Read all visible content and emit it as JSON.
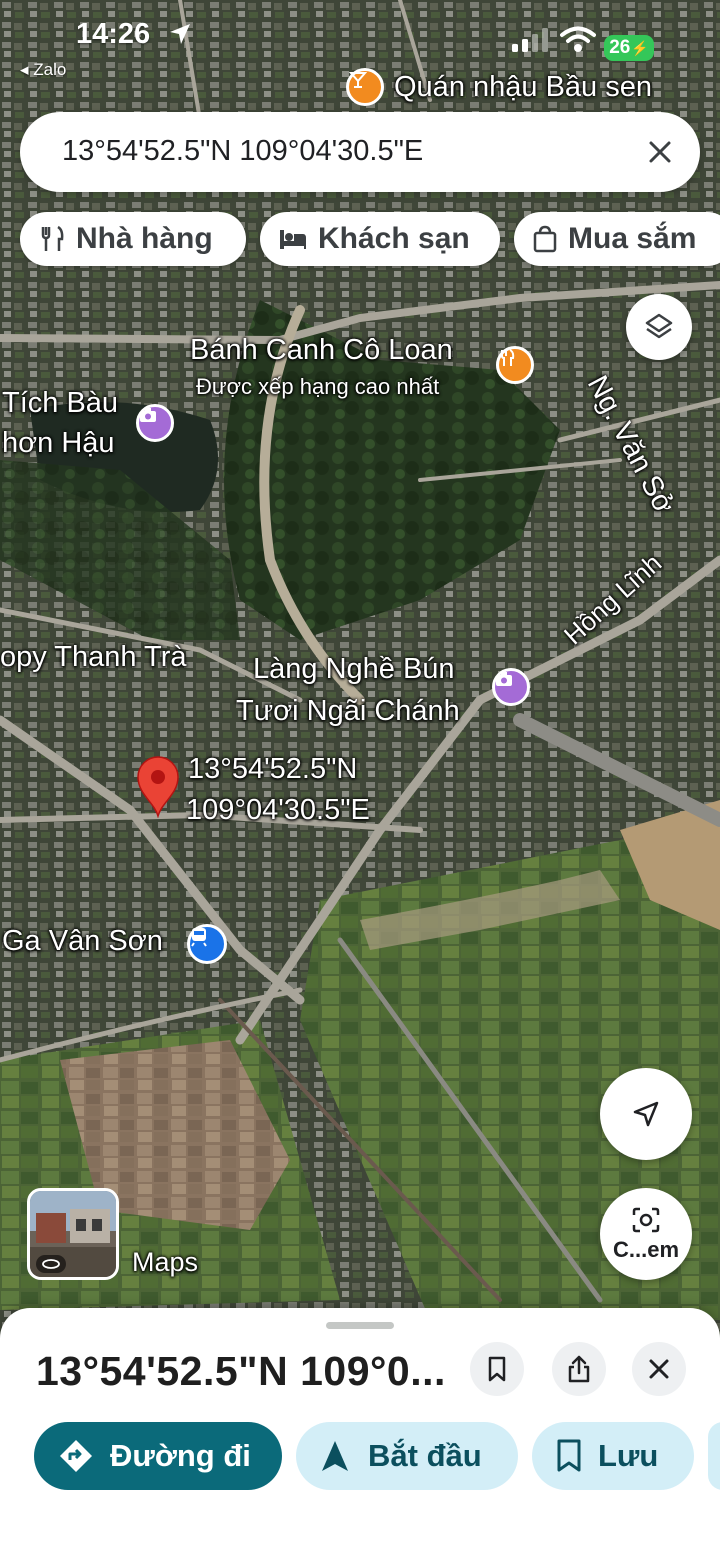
{
  "status_bar": {
    "time": "14:26",
    "back_app": "◂ Zalo",
    "battery": "26"
  },
  "search": {
    "query": "13°54'52.5\"N 109°04'30.5\"E"
  },
  "chips": [
    {
      "label": "Nhà hàng",
      "icon": "restaurant-icon"
    },
    {
      "label": "Khách sạn",
      "icon": "hotel-icon"
    },
    {
      "label": "Mua sắm",
      "icon": "shopping-bag-icon"
    }
  ],
  "map_labels": {
    "quan_nhau": "Quán nhậu Bầu sen",
    "banh_canh": "Bánh Canh Cô Loan",
    "banh_canh_sub": "Được xếp hạng cao nhất",
    "tich_bau_1": "Tích Bàu",
    "tich_bau_2": "hơn Hậu",
    "ng_van_so": "Ng. Văn Sở",
    "hong_linh": "Hồng Lĩnh",
    "thanh_tra": "opy Thanh Trà",
    "lang_nghe_1": "Làng Nghề Bún",
    "lang_nghe_2": "Tươi Ngãi Chánh",
    "pin_lat": "13°54'52.5\"N",
    "pin_lng": "109°04'30.5\"E",
    "ga_van_son": "Ga Vân Sơn",
    "maps": "Maps"
  },
  "colors": {
    "poi_orange": "#f28b1f",
    "poi_purple": "#a46bd6",
    "pin_red": "#ea4335",
    "directions_teal": "#0b6a7a",
    "action_light": "#d3eef7"
  },
  "fab": {
    "camera_label": "C...em"
  },
  "sheet": {
    "title": "13°54'52.5\"N 109°0...",
    "directions": "Đường đi",
    "start": "Bắt đầu",
    "save": "Lưu"
  }
}
